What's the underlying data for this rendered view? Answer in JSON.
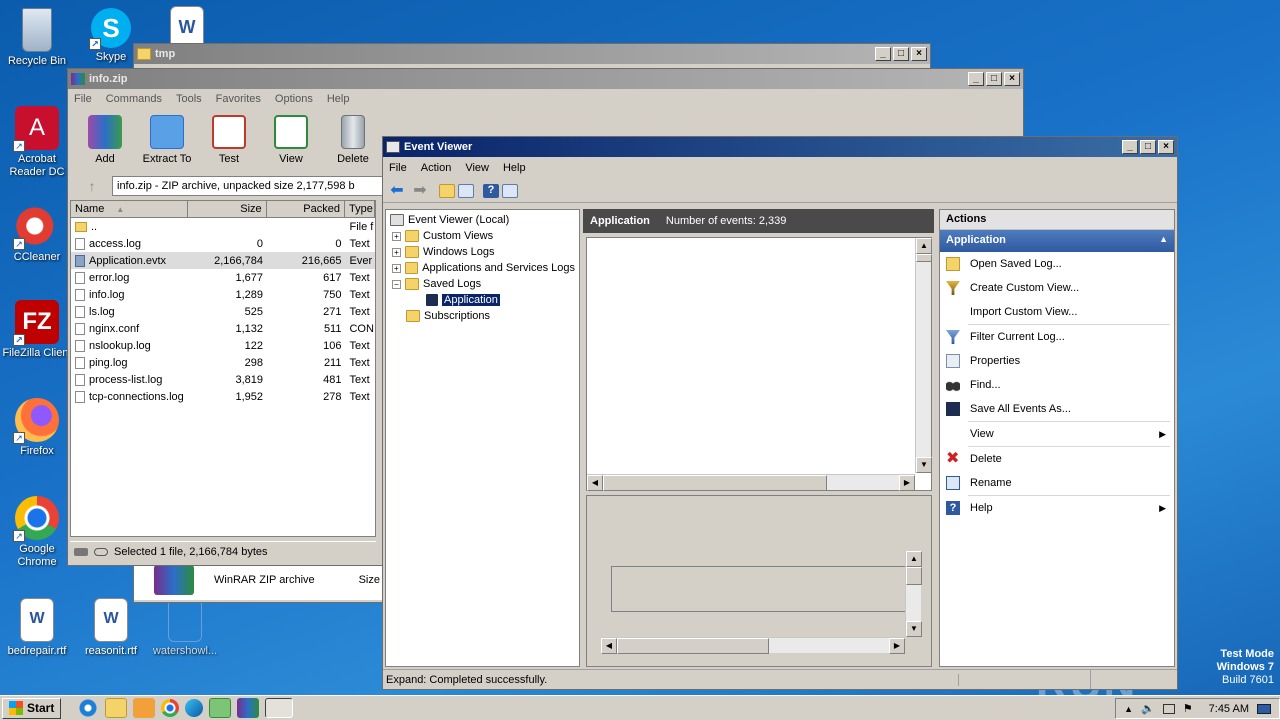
{
  "desktop": {
    "icons": [
      {
        "label": "Recycle Bin"
      },
      {
        "label": "Skype"
      },
      {
        "label": "Acrobat Reader DC"
      },
      {
        "label": "CCleaner"
      },
      {
        "label": "FileZilla Client"
      },
      {
        "label": "Firefox"
      },
      {
        "label": "Google Chrome"
      },
      {
        "label": "bedrepair.rtf"
      },
      {
        "label": "reasonit.rtf"
      },
      {
        "label": "watershowl..."
      }
    ],
    "watermark": {
      "brand": "ANY RUN",
      "line1": "Test Mode",
      "line2": "Windows 7",
      "line3": "Build 7601"
    }
  },
  "tmp_window": {
    "title": "tmp"
  },
  "winrar": {
    "title": "info.zip",
    "menu": [
      "File",
      "Commands",
      "Tools",
      "Favorites",
      "Options",
      "Help"
    ],
    "toolbar": [
      "Add",
      "Extract To",
      "Test",
      "View",
      "Delete"
    ],
    "path": "info.zip - ZIP archive, unpacked size 2,177,598 b",
    "columns": {
      "name": "Name",
      "size": "Size",
      "packed": "Packed",
      "type": "Type"
    },
    "files": [
      {
        "name": "..",
        "size": "",
        "packed": "",
        "type": "File f"
      },
      {
        "name": "access.log",
        "size": "0",
        "packed": "0",
        "type": "Text"
      },
      {
        "name": "Application.evtx",
        "size": "2,166,784",
        "packed": "216,665",
        "type": "Ever"
      },
      {
        "name": "error.log",
        "size": "1,677",
        "packed": "617",
        "type": "Text"
      },
      {
        "name": "info.log",
        "size": "1,289",
        "packed": "750",
        "type": "Text"
      },
      {
        "name": "ls.log",
        "size": "525",
        "packed": "271",
        "type": "Text"
      },
      {
        "name": "nginx.conf",
        "size": "1,132",
        "packed": "511",
        "type": "CON"
      },
      {
        "name": "nslookup.log",
        "size": "122",
        "packed": "106",
        "type": "Text"
      },
      {
        "name": "ping.log",
        "size": "298",
        "packed": "211",
        "type": "Text"
      },
      {
        "name": "process-list.log",
        "size": "3,819",
        "packed": "481",
        "type": "Text"
      },
      {
        "name": "tcp-connections.log",
        "size": "1,952",
        "packed": "278",
        "type": "Text"
      }
    ],
    "status": "Selected 1 file, 2,166,784 bytes",
    "below_item": {
      "name": "WinRAR ZIP archive",
      "col": "Size"
    }
  },
  "eventviewer": {
    "title": "Event Viewer",
    "menu": [
      "File",
      "Action",
      "View",
      "Help"
    ],
    "tree": {
      "root": "Event Viewer (Local)",
      "items": [
        "Custom Views",
        "Windows Logs",
        "Applications and Services Logs",
        "Saved Logs"
      ],
      "saved_child": "Application",
      "subscriptions": "Subscriptions"
    },
    "center": {
      "header_title": "Application",
      "header_count": "Number of events: 2,339"
    },
    "actions": {
      "title": "Actions",
      "section": "Application",
      "items": [
        "Open Saved Log...",
        "Create Custom View...",
        "Import Custom View...",
        "Filter Current Log...",
        "Properties",
        "Find...",
        "Save All Events As...",
        "View",
        "Delete",
        "Rename",
        "Help"
      ]
    },
    "status": "Expand:  Completed successfully."
  },
  "taskbar": {
    "start": "Start",
    "time": "7:45 AM"
  }
}
